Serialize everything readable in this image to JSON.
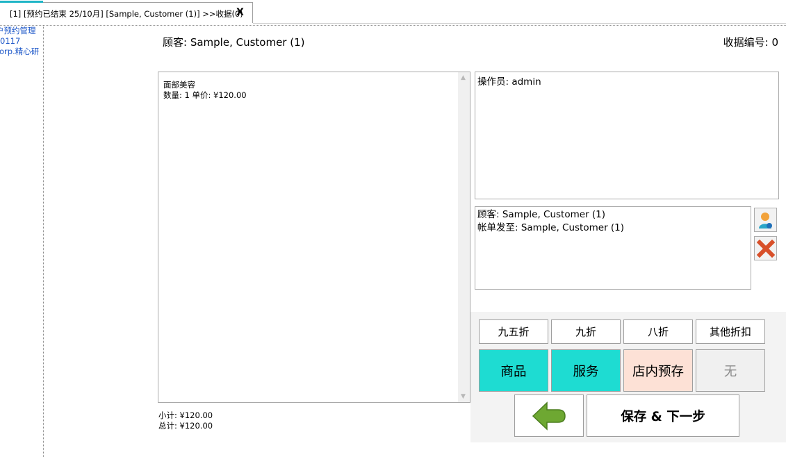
{
  "tab": {
    "label": "[1] [预约已结束 25/10月] [Sample, Customer (1)] >>收据(0)",
    "close": "X"
  },
  "sidebar": {
    "items": [
      {
        "label": "户预约管理"
      },
      {
        "label": "0117"
      },
      {
        "label": "orp.精心研"
      }
    ]
  },
  "header": {
    "customer": "顾客: Sample, Customer (1)",
    "receipt_no": "收据编号: 0"
  },
  "line_items": [
    {
      "name": "面部美容",
      "detail": "数量: 1      单价: ¥120.00"
    }
  ],
  "totals": {
    "subtotal": "小计: ¥120.00",
    "total": "总计: ¥120.00"
  },
  "operator": {
    "text": "操作员: admin"
  },
  "customer_info": {
    "line1": "顾客: Sample, Customer (1)",
    "line2": "帐单发至: Sample, Customer (1)"
  },
  "discounts": [
    {
      "label": "九五折"
    },
    {
      "label": "九折"
    },
    {
      "label": "八折"
    },
    {
      "label": "其他折扣"
    }
  ],
  "categories": [
    {
      "label": "商品",
      "color": "#1edcd2"
    },
    {
      "label": "服务",
      "color": "#1edcd2"
    },
    {
      "label": "店内预存",
      "color": "#fde1d6"
    },
    {
      "label": "无",
      "color": "#f0f0f0"
    }
  ],
  "actions": {
    "save_next": "保存 & 下一步",
    "back_icon": "arrow-left-icon"
  },
  "icons": {
    "change_customer": "user-icon",
    "remove_customer": "close-icon"
  },
  "colors": {
    "accent": "#1fb5c6",
    "teal_button": "#1edcd2",
    "peach_button": "#fde1d6",
    "link": "#1a55c8"
  }
}
